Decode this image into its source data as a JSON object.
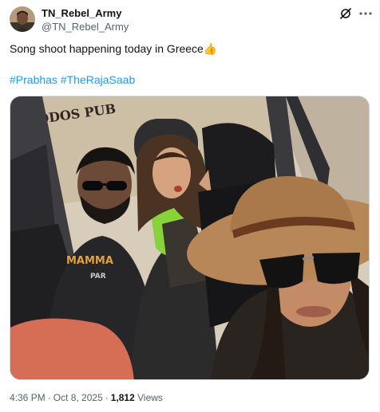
{
  "author": {
    "display_name": "TN_Rebel_Army",
    "handle": "@TN_Rebel_Army"
  },
  "tweet": {
    "text": "Song shoot happening today in Greece",
    "emoji": "👍",
    "hashtags": [
      "#Prabhas",
      "#TheRajaSaab"
    ]
  },
  "media": {
    "sign_text": "RODOS PUB",
    "shirt_text_1": "MAMMA",
    "shirt_text_2": "PAR"
  },
  "meta": {
    "time": "4:36 PM",
    "date": "Oct 8, 2025",
    "views_count": "1,812",
    "views_label": "Views",
    "separator": "·"
  },
  "icons": {
    "grok": "grok-icon",
    "more": "more-horizontal-icon"
  },
  "colors": {
    "accent": "#1d9bf0",
    "secondary_text": "#536471"
  }
}
